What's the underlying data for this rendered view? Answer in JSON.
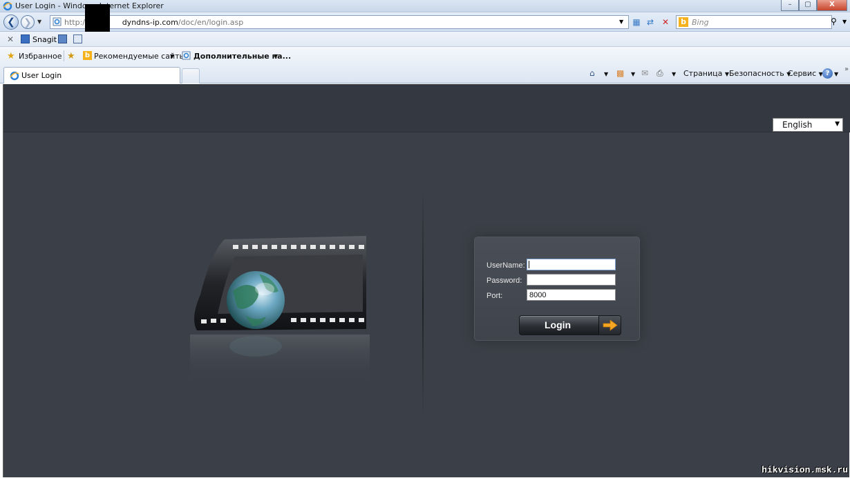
{
  "window": {
    "title": "User Login - Windows Internet Explorer",
    "controls": [
      "–",
      "▢",
      "X"
    ]
  },
  "address_bar": {
    "url_prefix": "http://",
    "url_domain": "dyndns-ip.com",
    "url_path": "/doc/en/login.asp",
    "search_placeholder": "Bing"
  },
  "snagit_bar": {
    "label": "Snagit"
  },
  "favorites_bar": {
    "favorites_label": "Избранное",
    "suggested_sites": "Рекомендуемые сайты",
    "addons": "Дополнительные на..."
  },
  "tab_bar": {
    "active_tab": "User Login",
    "commands": {
      "page": "Страница",
      "safety": "Безопасность",
      "tools": "Сервис"
    }
  },
  "page": {
    "language": {
      "selected": "English"
    },
    "login": {
      "username_label": "UserName:",
      "username_value": "",
      "password_label": "Password:",
      "password_value": "",
      "port_label": "Port:",
      "port_value": "8000",
      "button_label": "Login"
    }
  },
  "watermark": "hikvision.msk.ru",
  "colors": {
    "page_bg": "#3b3f47",
    "header_bg": "#343840",
    "arrow_accent": "#f5a623"
  }
}
